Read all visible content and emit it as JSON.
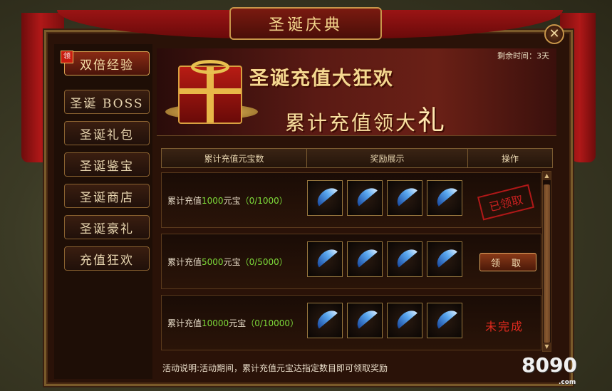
{
  "title": "圣诞庆典",
  "close_symbol": "✕",
  "remaining_time": "剩余时间：3天",
  "sidebar": {
    "badge": "领",
    "items": [
      {
        "label": "双倍经验"
      },
      {
        "label": "圣诞 BOSS"
      },
      {
        "label": "圣诞礼包"
      },
      {
        "label": "圣诞鉴宝"
      },
      {
        "label": "圣诞商店"
      },
      {
        "label": "圣诞豪礼"
      },
      {
        "label": "充值狂欢"
      }
    ]
  },
  "banner": {
    "line1": "圣诞充值大狂欢",
    "line2_main": "累计充值领大",
    "line2_big": "礼"
  },
  "table": {
    "headers": [
      "累计充值元宝数",
      "奖励展示",
      "操作"
    ],
    "rows": [
      {
        "prefix": "累计充值",
        "amount": "1000",
        "suffix": "元宝",
        "progress": "（0/1000）",
        "action": "已领取",
        "state": "claimed"
      },
      {
        "prefix": "累计充值",
        "amount": "5000",
        "suffix": "元宝",
        "progress": "（0/5000）",
        "action": "领 取",
        "state": "claimable"
      },
      {
        "prefix": "累计充值",
        "amount": "10000",
        "suffix": "元宝",
        "progress": "（0/10000）",
        "action": "未完成",
        "state": "incomplete"
      }
    ]
  },
  "scrollbar": {
    "up": "▲",
    "down": "▼"
  },
  "description": "活动说明:活动期间，累计充值元宝达指定数目即可领取奖励",
  "watermark": {
    "main": "8090",
    "sub": ".com"
  },
  "colors": {
    "accent_gold": "#f4d890",
    "progress_green": "#7fdc3a",
    "incomplete_red": "#e02a1e"
  },
  "icons": {
    "reward_item": "blue-feather-icon",
    "gift": "gift-box-icon"
  }
}
